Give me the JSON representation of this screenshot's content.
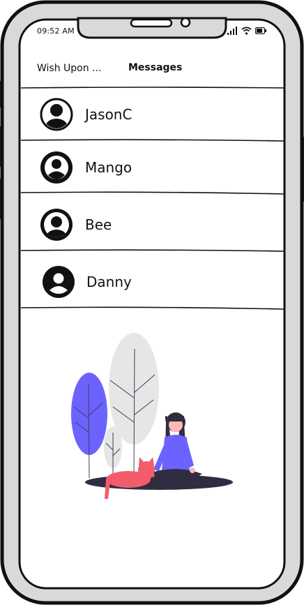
{
  "status_bar": {
    "time": "09:52 AM",
    "icons": [
      "signal-icon",
      "wifi-icon",
      "battery-icon"
    ]
  },
  "header": {
    "back_label": "Wish Upon ...",
    "title": "Messages"
  },
  "conversations": [
    {
      "name": "JasonC",
      "avatar_icon": "user-avatar-icon"
    },
    {
      "name": "Mango",
      "avatar_icon": "user-avatar-icon"
    },
    {
      "name": "Bee",
      "avatar_icon": "user-avatar-icon"
    },
    {
      "name": "Danny",
      "avatar_icon": "user-avatar-icon"
    }
  ],
  "colors": {
    "accent": "#6c63ff",
    "cat": "#f35c6b",
    "foliage_gray": "#e6e6e6",
    "ground": "#2f2e41"
  }
}
